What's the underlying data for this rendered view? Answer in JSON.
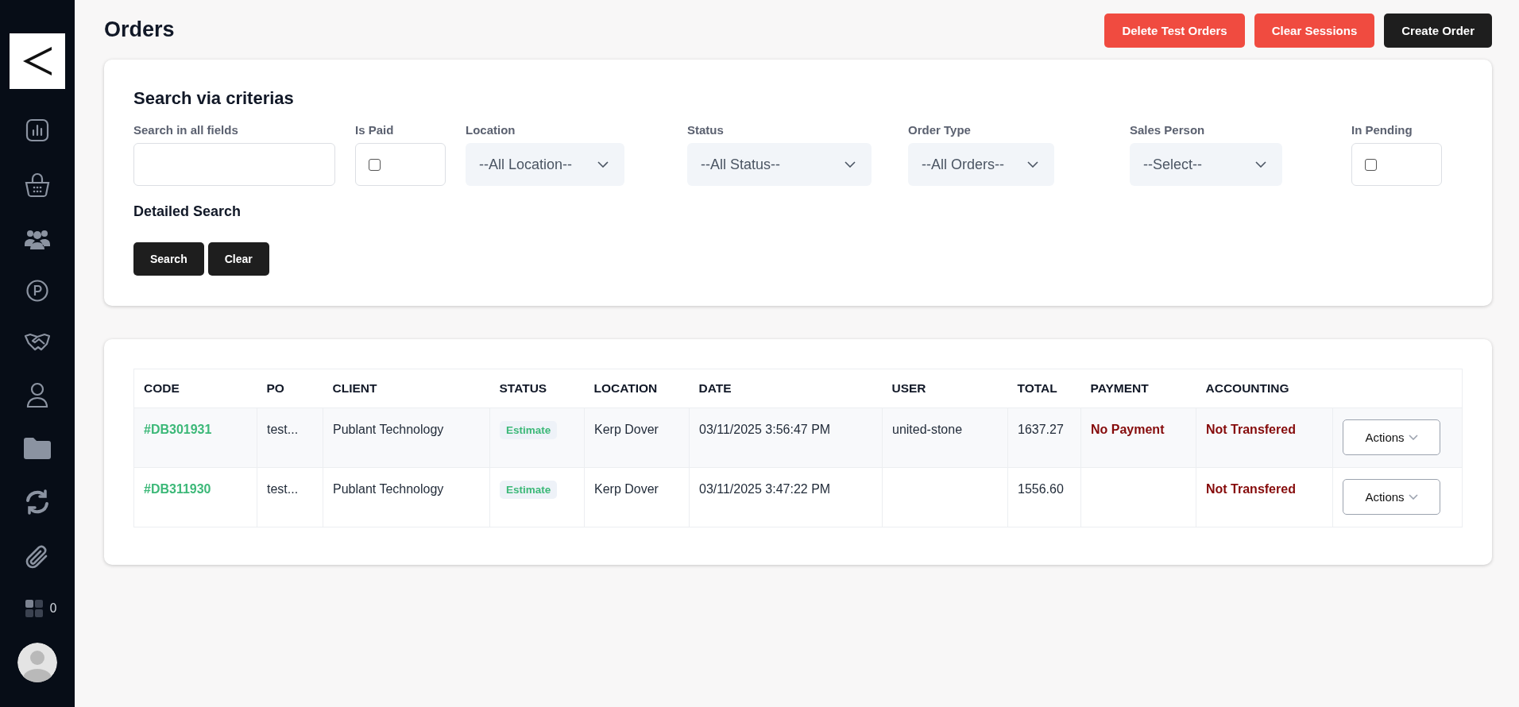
{
  "sidebar": {
    "items": [
      {
        "kind": "chart"
      },
      {
        "kind": "basket"
      },
      {
        "kind": "people"
      },
      {
        "kind": "parking"
      },
      {
        "kind": "handshake"
      },
      {
        "kind": "user"
      },
      {
        "kind": "folder"
      },
      {
        "kind": "sync"
      },
      {
        "kind": "paperclip"
      }
    ],
    "widget_count": "0"
  },
  "page": {
    "title": "Orders",
    "buttons": [
      {
        "label": "Delete Test Orders",
        "kind": "danger"
      },
      {
        "label": "Clear Sessions",
        "kind": "danger"
      },
      {
        "label": "Create Order",
        "kind": "dark"
      }
    ]
  },
  "search": {
    "title": "Search via criterias",
    "filters": [
      {
        "kind": "text",
        "label": "Search in all fields"
      },
      {
        "kind": "checkbox",
        "label": "Is Paid",
        "checked": false
      },
      {
        "kind": "select",
        "label": "Location",
        "value": "--All Location--"
      },
      {
        "kind": "select",
        "label": "Status",
        "value": "--All Status--"
      },
      {
        "kind": "select",
        "label": "Order Type",
        "value": "--All Orders--"
      },
      {
        "kind": "select",
        "label": "Sales Person",
        "value": "--Select--"
      },
      {
        "kind": "checkbox",
        "label": "In Pending",
        "checked": false
      }
    ],
    "detailed_search": "Detailed Search",
    "buttons": [
      "Search",
      "Clear"
    ]
  },
  "table": {
    "columns": [
      "CODE",
      "PO",
      "CLIENT",
      "STATUS",
      "LOCATION",
      "DATE",
      "USER",
      "TOTAL",
      "PAYMENT",
      "ACCOUNTING"
    ],
    "rows": [
      {
        "code": "#DB301931",
        "po": "test...",
        "client": "Publant Technology",
        "status": "Estimate",
        "location": "Kerp Dover",
        "date": "03/11/2025 3:56:47 PM",
        "user": "united-stone",
        "total": "1637.27",
        "payment": "No Payment",
        "accounting": "Not Transfered",
        "action": "Actions"
      },
      {
        "code": "#DB311930",
        "po": "test...",
        "client": "Publant Technology",
        "status": "Estimate",
        "location": "Kerp Dover",
        "date": "03/11/2025 3:47:22 PM",
        "total": "1556.60",
        "accounting": "Not Transfered",
        "action": "Actions"
      }
    ]
  }
}
